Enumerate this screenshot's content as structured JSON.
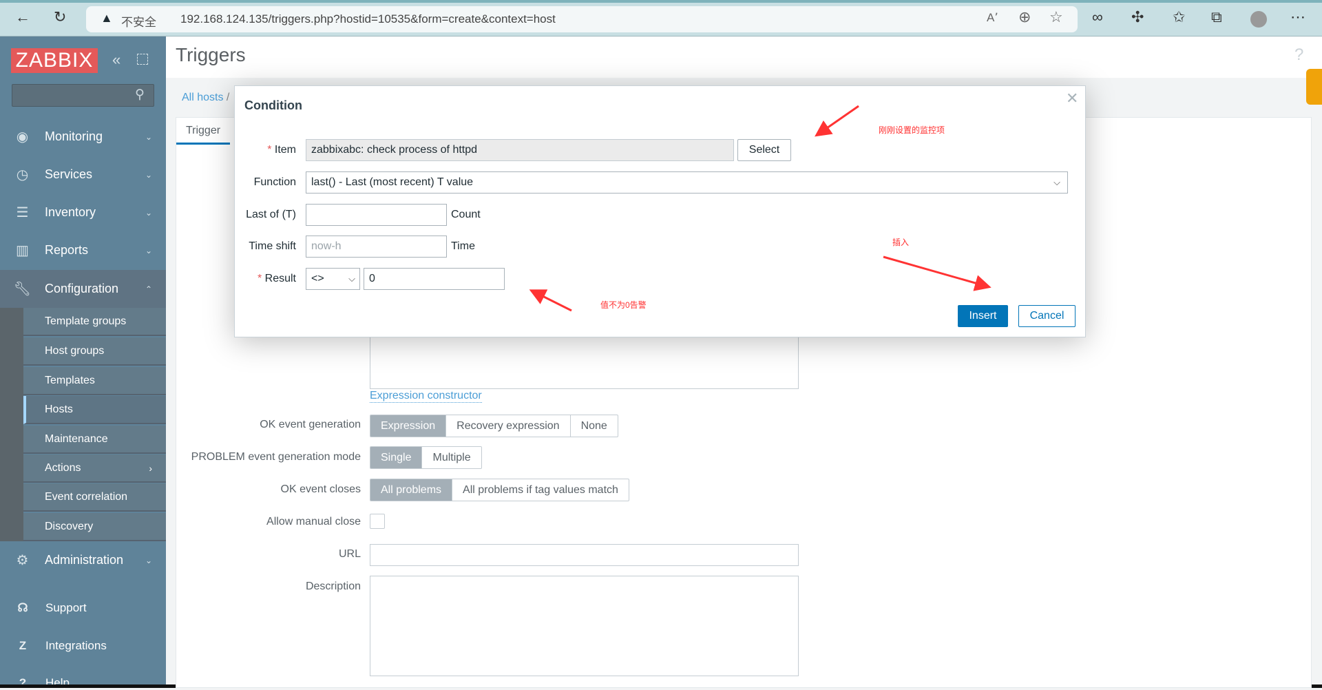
{
  "browser": {
    "security_label": "不安全",
    "url": "192.168.124.135/triggers.php?hostid=10535&form=create&context=host"
  },
  "sidebar": {
    "logo": "ZABBIX",
    "items": [
      {
        "label": "Monitoring",
        "icon": "eye-icon"
      },
      {
        "label": "Services",
        "icon": "clock-icon"
      },
      {
        "label": "Inventory",
        "icon": "list-icon"
      },
      {
        "label": "Reports",
        "icon": "bar-chart-icon"
      },
      {
        "label": "Configuration",
        "icon": "wrench-icon"
      },
      {
        "label": "Administration",
        "icon": "gear-icon"
      }
    ],
    "config_sub": [
      "Template groups",
      "Host groups",
      "Templates",
      "Hosts",
      "Maintenance",
      "Actions",
      "Event correlation",
      "Discovery"
    ],
    "footer": [
      {
        "label": "Support"
      },
      {
        "label": "Integrations"
      },
      {
        "label": "Help"
      }
    ]
  },
  "page": {
    "title": "Triggers",
    "help": "?",
    "breadcrumb": "All hosts",
    "breadcrumb_sep": "/",
    "tab": "Trigger"
  },
  "form": {
    "expression_constructor": "Expression constructor",
    "ok_event_generation": {
      "label": "OK event generation",
      "options": [
        "Expression",
        "Recovery expression",
        "None"
      ],
      "selected": "Expression"
    },
    "problem_mode": {
      "label": "PROBLEM event generation mode",
      "options": [
        "Single",
        "Multiple"
      ],
      "selected": "Single"
    },
    "ok_event_closes": {
      "label": "OK event closes",
      "options": [
        "All problems",
        "All problems if tag values match"
      ],
      "selected": "All problems"
    },
    "allow_manual_close": {
      "label": "Allow manual close",
      "checked": false
    },
    "url": {
      "label": "URL",
      "value": ""
    },
    "description": {
      "label": "Description",
      "value": ""
    }
  },
  "dialog": {
    "title": "Condition",
    "item": {
      "label": "Item",
      "value": "zabbixabc: check process of httpd",
      "select": "Select"
    },
    "function": {
      "label": "Function",
      "value": "last() - Last (most recent) T value"
    },
    "last_of": {
      "label": "Last of (T)",
      "value": "",
      "unit": "Count"
    },
    "time_shift": {
      "label": "Time shift",
      "placeholder": "now-h",
      "unit": "Time"
    },
    "result": {
      "label": "Result",
      "operator": "<>",
      "value": "0"
    },
    "insert": "Insert",
    "cancel": "Cancel"
  },
  "annotations": {
    "item_note": "刚刚设置的监控项",
    "insert_note": "插入",
    "result_note": "值不为0告警",
    "color": "#ff2f2f"
  }
}
